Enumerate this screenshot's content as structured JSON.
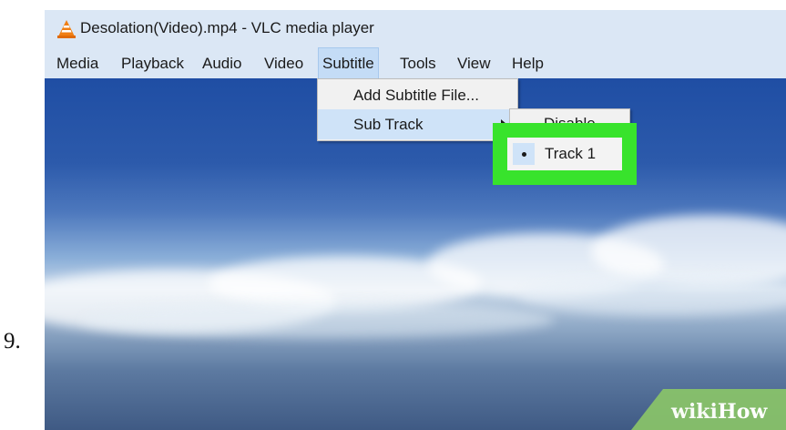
{
  "step": {
    "number": "9."
  },
  "window": {
    "title": "Desolation(Video).mp4 - VLC media player",
    "icon": "vlc-cone-icon"
  },
  "menubar": {
    "items": [
      {
        "label": "Media"
      },
      {
        "label": "Playback"
      },
      {
        "label": "Audio"
      },
      {
        "label": "Video"
      },
      {
        "label": "Subtitle",
        "active": true
      },
      {
        "label": "Tools"
      },
      {
        "label": "View"
      },
      {
        "label": "Help"
      }
    ]
  },
  "subtitle_menu": {
    "items": [
      {
        "label": "Add Subtitle File..."
      },
      {
        "label": "Sub Track",
        "has_submenu": true,
        "highlighted": true
      }
    ]
  },
  "sub_track_menu": {
    "items": [
      {
        "label": "Disable"
      },
      {
        "label": "Track 1",
        "selected": true
      }
    ]
  },
  "colors": {
    "highlight_box": "#38e32c",
    "menu_highlight": "#cfe3f8",
    "menubar_bg": "#dbe7f5"
  },
  "watermark": {
    "part1": "wiki",
    "part2": "How"
  }
}
